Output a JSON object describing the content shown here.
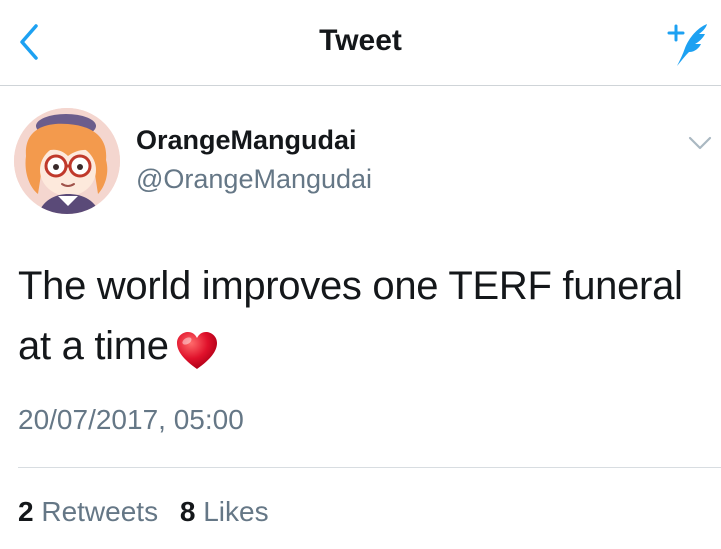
{
  "nav": {
    "title": "Tweet",
    "back_icon": "chevron-left-icon",
    "compose_icon": "compose-tweet-icon"
  },
  "author": {
    "display_name": "OrangeMangudai",
    "handle": "@OrangeMangudai",
    "avatar_icon": "avatar"
  },
  "tweet": {
    "text_line1": "The world improves one TERF funeral",
    "text_line2": "at a time",
    "emoji_icon": "red-heart-icon",
    "timestamp": "20/07/2017, 05:00"
  },
  "stats": {
    "retweets_count": "2",
    "retweets_label": "Retweets",
    "likes_count": "8",
    "likes_label": "Likes"
  },
  "colors": {
    "accent": "#1da1f2",
    "text_primary": "#14171a",
    "text_secondary": "#657786",
    "divider": "#d8dde1",
    "heart": "#e0245e"
  }
}
